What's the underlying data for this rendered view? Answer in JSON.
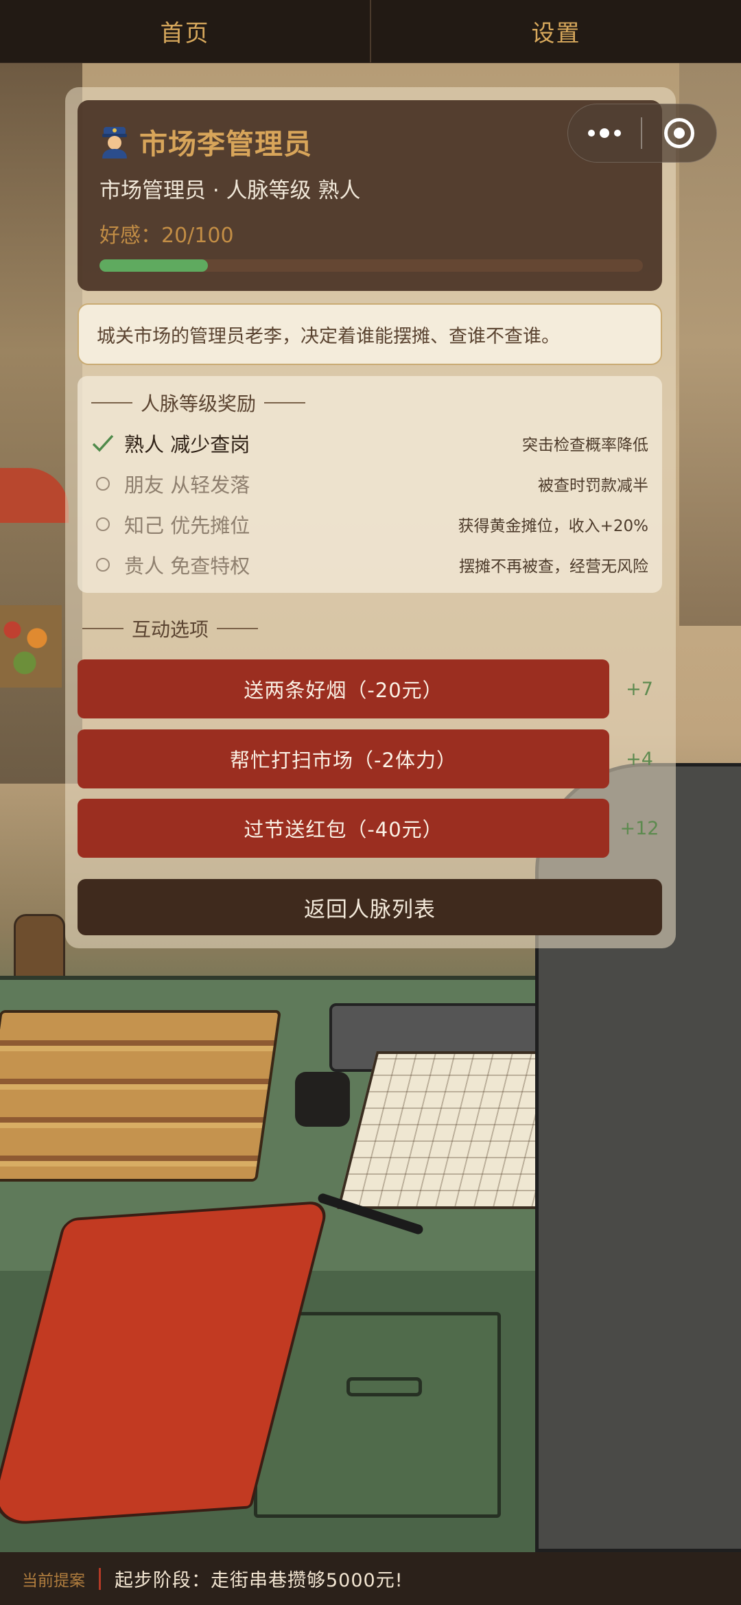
{
  "nav": {
    "tabs": [
      {
        "label": "首页"
      },
      {
        "label": "设置"
      }
    ]
  },
  "capsule": {
    "more_icon": "more-dots-icon",
    "close_icon": "target-close-icon"
  },
  "npc": {
    "icon": "police-officer-icon",
    "name": "市场李管理员",
    "subtitle": "市场管理员 · 人脉等级 熟人",
    "favor_text": "好感：20/100",
    "favor_value": 20,
    "favor_max": 100,
    "favor_color": "#5faa5f"
  },
  "description": "城关市场的管理员老李，决定着谁能摆摊、查谁不查谁。",
  "rewards": {
    "title": "人脉等级奖励",
    "items": [
      {
        "name": "熟人 减少查岗",
        "desc": "突击检查概率降低",
        "unlocked": true
      },
      {
        "name": "朋友 从轻发落",
        "desc": "被查时罚款减半",
        "unlocked": false
      },
      {
        "name": "知己 优先摊位",
        "desc": "获得黄金摊位，收入+20%",
        "unlocked": false
      },
      {
        "name": "贵人 免查特权",
        "desc": "摆摊不再被查，经营无风险",
        "unlocked": false
      }
    ]
  },
  "actions": {
    "title": "互动选项",
    "items": [
      {
        "label": "送两条好烟（-20元）",
        "gain": "+7"
      },
      {
        "label": "帮忙打扫市场（-2体力）",
        "gain": "+4"
      },
      {
        "label": "过节送红包（-40元）",
        "gain": "+12"
      }
    ],
    "button_color": "#9b2e20"
  },
  "back_button": "返回人脉列表",
  "bottom": {
    "label": "当前提案",
    "text": "起步阶段：走街串巷攒够5000元!"
  }
}
